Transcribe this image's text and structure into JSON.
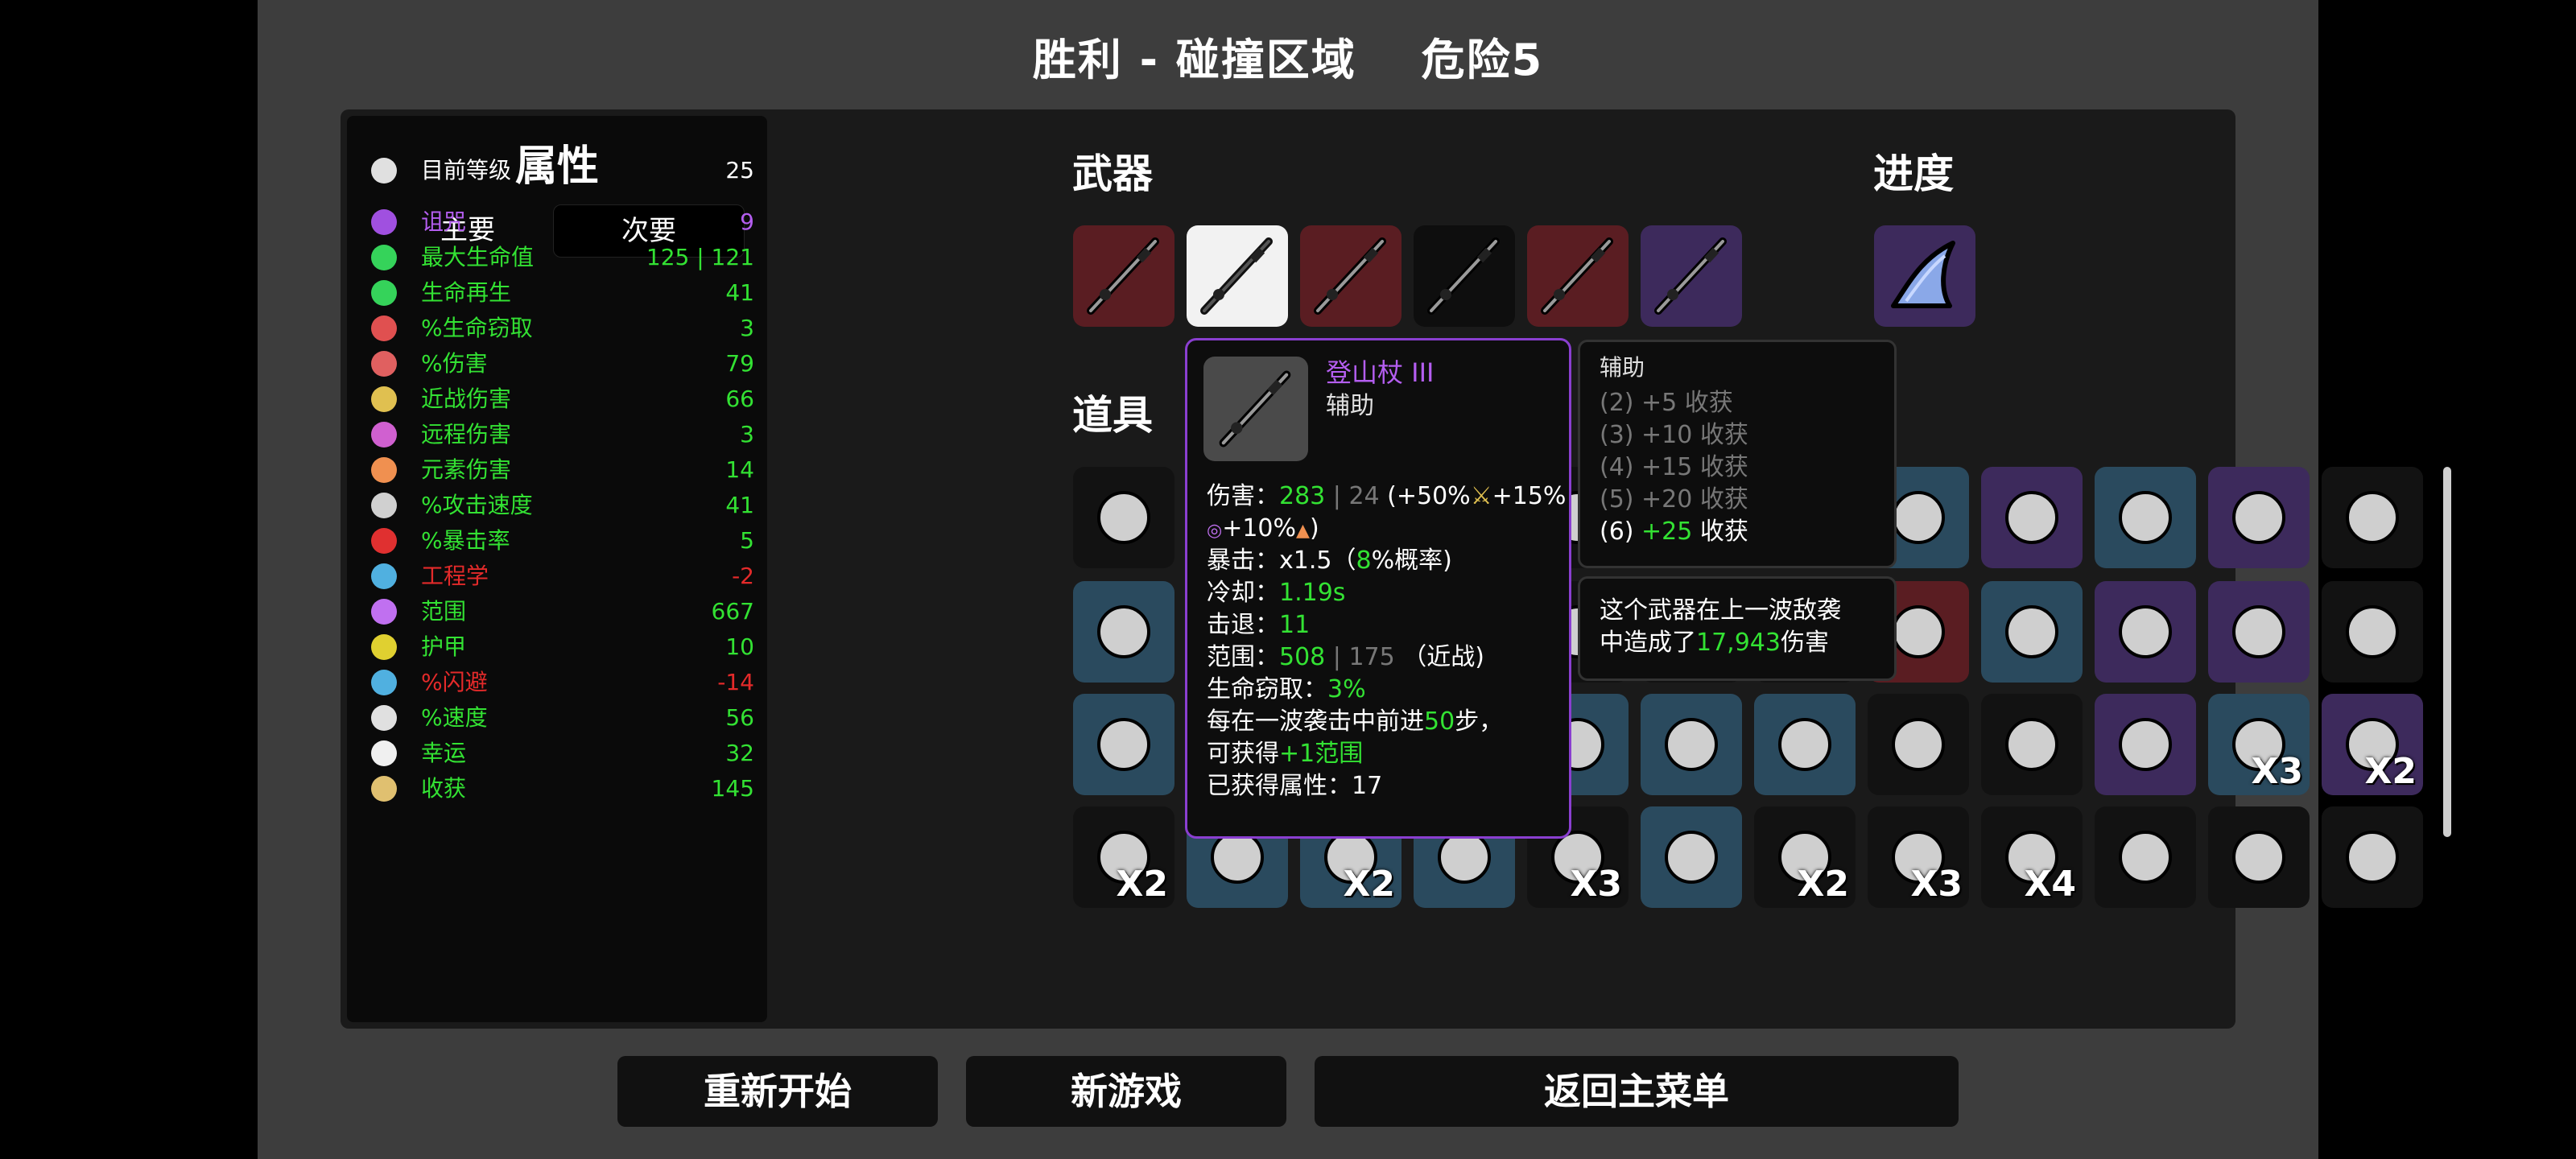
{
  "header": {
    "result": "胜利 - 碰撞区域",
    "danger": "危险5"
  },
  "stats": {
    "title": "属性",
    "tabs": {
      "main": "主要",
      "secondary": "次要"
    },
    "rows": [
      {
        "name": "目前等级",
        "value": "25",
        "color": "#ffffff",
        "nameColor": "#ffffff",
        "icon": "level-icon",
        "iconColor": "#e0e0e0"
      },
      {
        "name": "诅咒",
        "value": "9",
        "color": "#b45ef0",
        "nameColor": "#b45ef0",
        "icon": "eye-icon",
        "iconColor": "#a050e0"
      },
      {
        "name": "最大生命值",
        "value": "125 | 121",
        "color": "#33e233",
        "nameColor": "#33e233",
        "icon": "heart-icon",
        "iconColor": "#35d35a"
      },
      {
        "name": "生命再生",
        "value": "41",
        "color": "#33e233",
        "nameColor": "#33e233",
        "icon": "heart-plus-icon",
        "iconColor": "#35d35a"
      },
      {
        "name": "%生命窃取",
        "value": "3",
        "color": "#33e233",
        "nameColor": "#33e233",
        "icon": "fang-icon",
        "iconColor": "#e05050"
      },
      {
        "name": "%伤害",
        "value": "79",
        "color": "#33e233",
        "nameColor": "#33e233",
        "icon": "muscle-icon",
        "iconColor": "#e06060"
      },
      {
        "name": "近战伤害",
        "value": "66",
        "color": "#33e233",
        "nameColor": "#33e233",
        "icon": "sword-icon",
        "iconColor": "#e0c050"
      },
      {
        "name": "远程伤害",
        "value": "3",
        "color": "#33e233",
        "nameColor": "#33e233",
        "icon": "bow-icon",
        "iconColor": "#d060d0"
      },
      {
        "name": "元素伤害",
        "value": "14",
        "color": "#33e233",
        "nameColor": "#33e233",
        "icon": "flame-icon",
        "iconColor": "#f09050"
      },
      {
        "name": "%攻击速度",
        "value": "41",
        "color": "#33e233",
        "nameColor": "#33e233",
        "icon": "hourglass-icon",
        "iconColor": "#d0d0d0"
      },
      {
        "name": "%暴击率",
        "value": "5",
        "color": "#33e233",
        "nameColor": "#33e233",
        "icon": "crit-icon",
        "iconColor": "#e03030"
      },
      {
        "name": "工程学",
        "value": "-2",
        "color": "#e42a2a",
        "nameColor": "#e42a2a",
        "icon": "wrench-icon",
        "iconColor": "#50b0e0"
      },
      {
        "name": "范围",
        "value": "667",
        "color": "#33e233",
        "nameColor": "#33e233",
        "icon": "range-icon",
        "iconColor": "#c070f0"
      },
      {
        "name": "护甲",
        "value": "10",
        "color": "#33e233",
        "nameColor": "#33e233",
        "icon": "shield-icon",
        "iconColor": "#e0d030"
      },
      {
        "name": "%闪避",
        "value": "-14",
        "color": "#e42a2a",
        "nameColor": "#e42a2a",
        "icon": "dodge-icon",
        "iconColor": "#50b0e0"
      },
      {
        "name": "%速度",
        "value": "56",
        "color": "#33e233",
        "nameColor": "#33e233",
        "icon": "boot-icon",
        "iconColor": "#e0e0e0"
      },
      {
        "name": "幸运",
        "value": "32",
        "color": "#33e233",
        "nameColor": "#33e233",
        "icon": "dice-icon",
        "iconColor": "#f0f0f0"
      },
      {
        "name": "收获",
        "value": "145",
        "color": "#33e233",
        "nameColor": "#33e233",
        "icon": "wheat-icon",
        "iconColor": "#e0c070"
      }
    ]
  },
  "weapons": {
    "title": "武器",
    "slots": [
      {
        "bg": "#5a1d22",
        "selected": false
      },
      {
        "bg": "#f2f2f2",
        "selected": true
      },
      {
        "bg": "#5a1d22",
        "selected": false
      },
      {
        "bg": "#0e0e0e",
        "selected": false
      },
      {
        "bg": "#5a1d22",
        "selected": false
      },
      {
        "bg": "#3d2a5c",
        "selected": false
      }
    ]
  },
  "progress": {
    "title": "进度"
  },
  "items": {
    "title": "道具",
    "rows": [
      [
        {
          "icon": "egg-icon",
          "bg": "#121212",
          "count": ""
        },
        {
          "icon": "item-icon",
          "bg": "#121212",
          "count": ""
        },
        {
          "icon": "item-icon",
          "bg": "#121212",
          "count": ""
        },
        {
          "icon": "item-icon",
          "bg": "#121212",
          "count": ""
        },
        {
          "icon": "item-icon",
          "bg": "#121212",
          "count": ""
        },
        {
          "icon": "item-icon",
          "bg": "#121212",
          "count": ""
        },
        {
          "icon": "item-icon",
          "bg": "#121212",
          "count": ""
        },
        {
          "icon": "axe-icon",
          "bg": "#2a4a5e",
          "count": ""
        },
        {
          "icon": "ghost-icon",
          "bg": "#3d2a5c",
          "count": ""
        },
        {
          "icon": "jar-icon",
          "bg": "#2a4a5e",
          "count": ""
        },
        {
          "icon": "heart-ice-icon",
          "bg": "#3d2a5c",
          "count": ""
        },
        {
          "icon": "cake-icon",
          "bg": "#121212",
          "count": ""
        }
      ],
      [
        {
          "icon": "rabbit-icon",
          "bg": "#2a4a5e",
          "count": ""
        },
        {
          "icon": "item-icon",
          "bg": "#121212",
          "count": ""
        },
        {
          "icon": "item-icon",
          "bg": "#121212",
          "count": ""
        },
        {
          "icon": "item-icon",
          "bg": "#121212",
          "count": ""
        },
        {
          "icon": "item-icon",
          "bg": "#121212",
          "count": ""
        },
        {
          "icon": "item-icon",
          "bg": "#121212",
          "count": ""
        },
        {
          "icon": "item-icon",
          "bg": "#121212",
          "count": ""
        },
        {
          "icon": "panda-icon",
          "bg": "#5a1d22",
          "count": ""
        },
        {
          "icon": "sandbox-icon",
          "bg": "#2a4a5e",
          "count": ""
        },
        {
          "icon": "bottle-icon",
          "bg": "#3d2a5c",
          "count": ""
        },
        {
          "icon": "potion-icon",
          "bg": "#3d2a5c",
          "count": ""
        },
        {
          "icon": "syringe-icon",
          "bg": "#121212",
          "count": ""
        }
      ],
      [
        {
          "icon": "flask-icon",
          "bg": "#2a4a5e",
          "count": ""
        },
        {
          "icon": "item-icon",
          "bg": "#121212",
          "count": ""
        },
        {
          "icon": "item-icon",
          "bg": "#121212",
          "count": ""
        },
        {
          "icon": "item-icon",
          "bg": "#121212",
          "count": ""
        },
        {
          "icon": "item-icon",
          "bg": "#2a4a5e",
          "count": ""
        },
        {
          "icon": "claw-icon",
          "bg": "#2a4a5e",
          "count": ""
        },
        {
          "icon": "belt-icon",
          "bg": "#2a4a5e",
          "count": ""
        },
        {
          "icon": "duck-icon",
          "bg": "#121212",
          "count": ""
        },
        {
          "icon": "tongue-icon",
          "bg": "#121212",
          "count": ""
        },
        {
          "icon": "alien-icon",
          "bg": "#3d2a5c",
          "count": ""
        },
        {
          "icon": "wasp-icon",
          "bg": "#2a4a5e",
          "count": "X3"
        },
        {
          "icon": "fish-icon",
          "bg": "#3d2a5c",
          "count": "X2"
        }
      ],
      [
        {
          "icon": "bear-icon",
          "bg": "#121212",
          "count": "X2"
        },
        {
          "icon": "leech-icon",
          "bg": "#2a4a5e",
          "count": ""
        },
        {
          "icon": "frog-icon",
          "bg": "#2a4a5e",
          "count": "X2"
        },
        {
          "icon": "octopus-icon",
          "bg": "#2a4a5e",
          "count": ""
        },
        {
          "icon": "dart-icon",
          "bg": "#121212",
          "count": "X3"
        },
        {
          "icon": "shell-icon",
          "bg": "#2a4a5e",
          "count": ""
        },
        {
          "icon": "snail-icon",
          "bg": "#121212",
          "count": "X2"
        },
        {
          "icon": "boxing-glove-icon",
          "bg": "#121212",
          "count": "X3"
        },
        {
          "icon": "lizard-icon",
          "bg": "#121212",
          "count": "X4"
        },
        {
          "icon": "robot-icon",
          "bg": "#121212",
          "count": ""
        },
        {
          "icon": "sprout-icon",
          "bg": "#121212",
          "count": ""
        },
        {
          "icon": "face-icon",
          "bg": "#121212",
          "count": ""
        }
      ]
    ]
  },
  "tooltip": {
    "name": "登山杖 III",
    "type": "辅助",
    "damage_label": "伤害：",
    "damage_value": "283",
    "damage_base": " | 24 ",
    "damage_scaling": "(+50%",
    "damage_scaling2": "+15%",
    "damage_scaling3": "+10%",
    "damage_scaling_end": ")",
    "crit_label": "暴击：",
    "crit_value": "x1.5（",
    "crit_chance": "8",
    "crit_end": "%概率)",
    "cooldown_label": "冷却：",
    "cooldown_value": "1.19s",
    "knockback_label": "击退：",
    "knockback_value": "11",
    "range_label": "范围：",
    "range_value": "508",
    "range_base": " | 175 ",
    "range_type": "（近战)",
    "lifesteal_label": "生命窃取：",
    "lifesteal_value": "3%",
    "effect_line1_a": "每在一波袭击中前进",
    "effect_line1_b": "50",
    "effect_line1_c": "步，",
    "effect_line2_a": "可获得",
    "effect_line2_b": "+1范围",
    "gained_label": "已获得属性：17"
  },
  "set_bonus": {
    "title": "辅助",
    "lines": [
      "(2) +5 收获",
      "(3) +10 收获",
      "(4) +15 收获",
      "(5) +20 收获"
    ],
    "active_prefix": "(6) ",
    "active_value": "+25",
    "active_suffix": " 收获"
  },
  "damage_dealt": {
    "line1": "这个武器在上一波敌袭",
    "line2_a": "中造成了",
    "line2_b": "17,943",
    "line2_c": "伤害"
  },
  "buttons": {
    "restart": "重新开始",
    "new_game": "新游戏",
    "main_menu": "返回主菜单"
  },
  "colors": {
    "green": "#33e233",
    "red": "#e42a2a",
    "purple": "#b45ef0",
    "blue_tier": "#2a4a5e",
    "purple_tier": "#3d2a5c",
    "red_tier": "#5a1d22"
  }
}
